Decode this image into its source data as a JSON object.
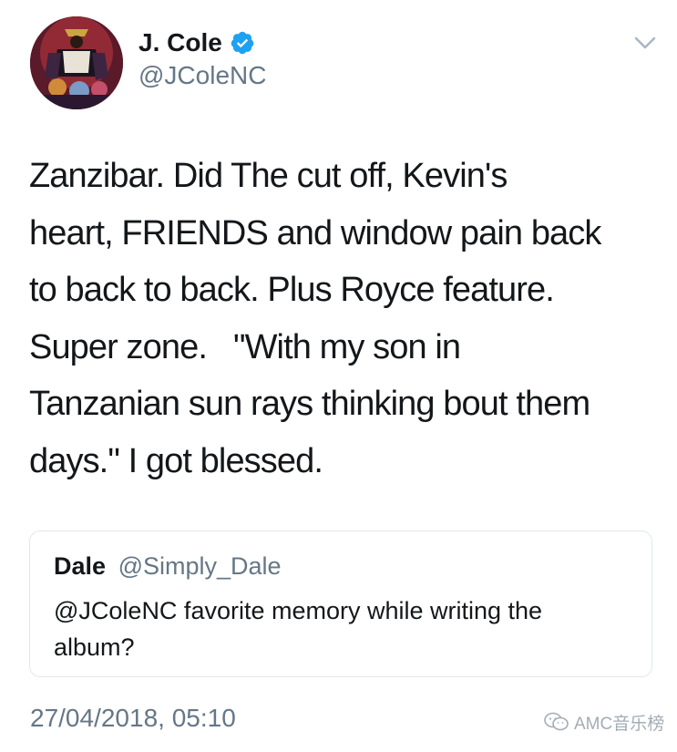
{
  "author": {
    "display_name": "J. Cole",
    "handle": "@JColeNC",
    "verified": true,
    "avatar_icon": "album-cover-avatar"
  },
  "tweet": {
    "text_lines": [
      "Zanzibar. Did The cut off, Kevin's",
      "heart, FRIENDS and window pain back",
      "to back to back. Plus Royce feature.",
      "Super zone.   \"With my son in",
      "Tanzanian sun rays thinking bout them",
      "days.\" I got blessed."
    ],
    "timestamp": "27/04/2018, 05:10"
  },
  "quoted_tweet": {
    "display_name": "Dale",
    "handle": "@Simply_Dale",
    "text_lines": [
      "@JColeNC favorite memory while writing the",
      "album?"
    ]
  },
  "watermark": {
    "text": "AMC音乐榜",
    "icon": "wechat-icon"
  },
  "colors": {
    "text": "#14171a",
    "secondary": "#657786",
    "verified_blue": "#1da1f2",
    "border": "#e1e8ed"
  }
}
